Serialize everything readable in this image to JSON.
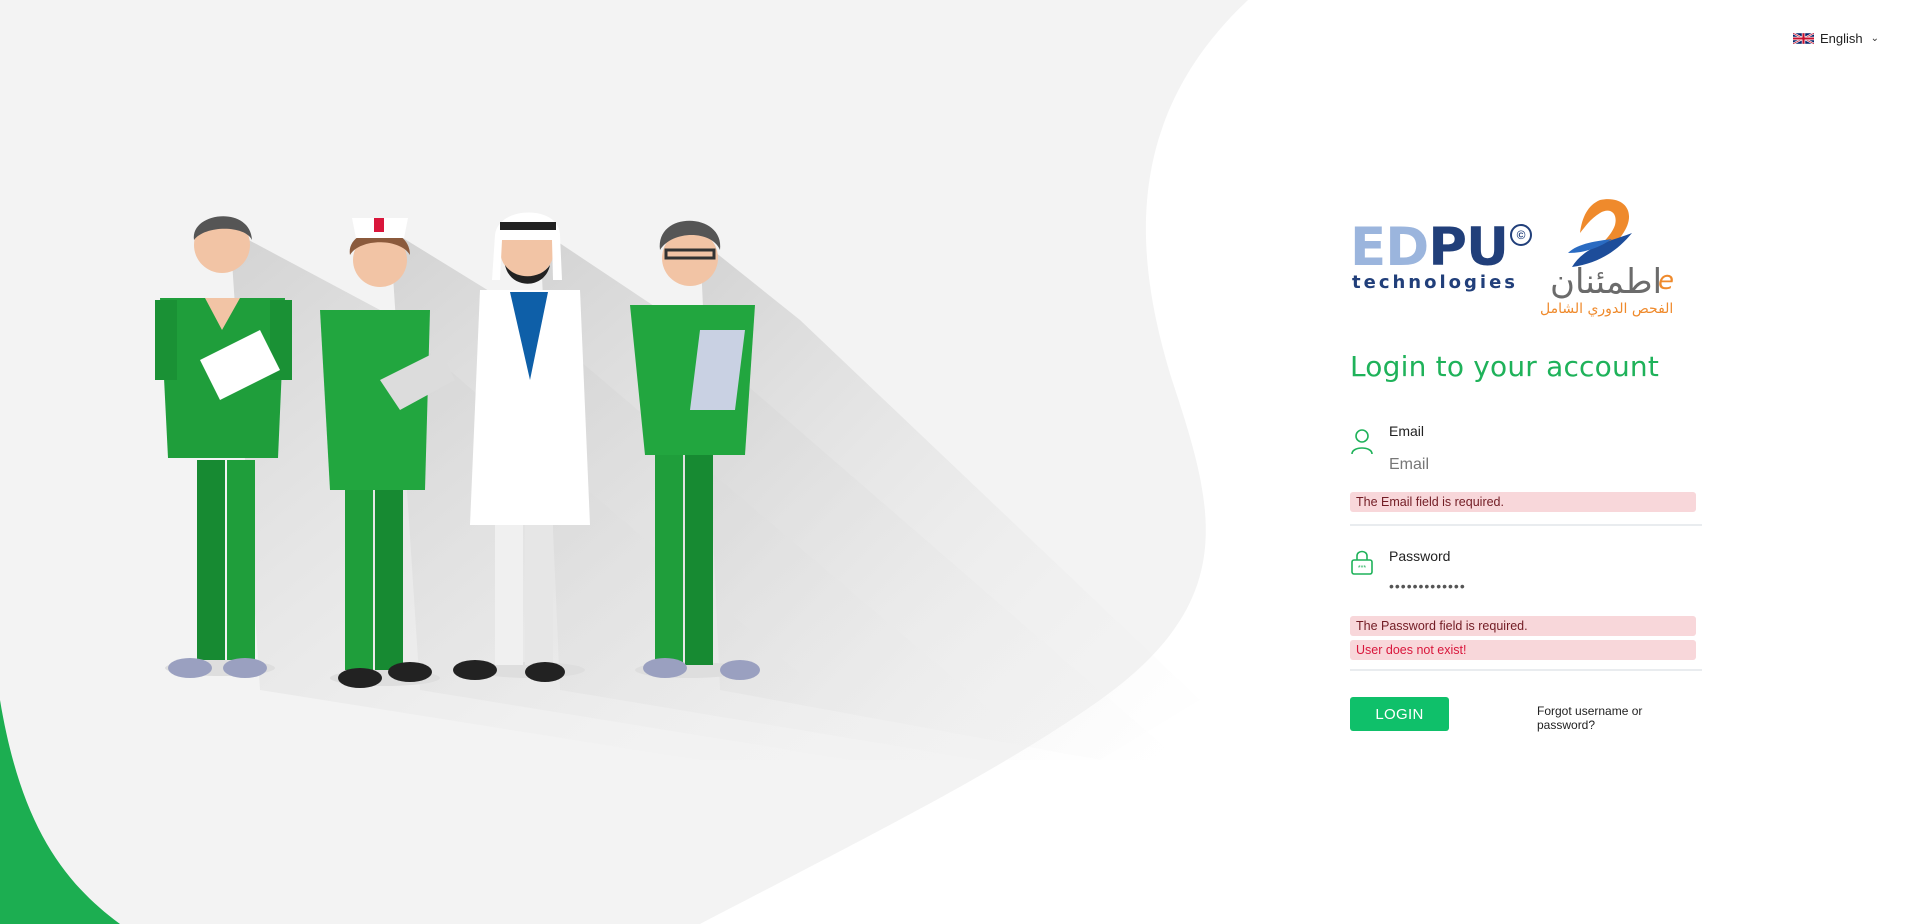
{
  "language": {
    "selected": "English",
    "flag_icon": "uk-flag-icon"
  },
  "logos": {
    "edpu_word_a": "ED",
    "edpu_word_b": "PU",
    "edpu_copyright": "©",
    "edpu_tagline": "technologies",
    "itmenan_name": "اطمئنان",
    "itmenan_prefix": "e",
    "itmenan_tagline": "الفحص الدوري الشامل"
  },
  "login": {
    "title": "Login to your account",
    "email_label": "Email",
    "email_placeholder": "Email",
    "email_value": "",
    "email_error": "The Email field is required.",
    "password_label": "Password",
    "password_value": "*************",
    "password_error": "The Password field is required.",
    "user_error": "User does not exist!",
    "login_button": "LOGIN",
    "forgot_link": "Forgot username or password?"
  },
  "colors": {
    "accent_green": "#1fb25a",
    "button_green": "#0fc06a",
    "error_bg": "#f8d7da",
    "error_text": "#721c24",
    "error_text_red": "#d9163b",
    "edpu_dark": "#213f7a",
    "edpu_light": "#9bb5dd",
    "itmenan_orange": "#ef8a2c"
  }
}
